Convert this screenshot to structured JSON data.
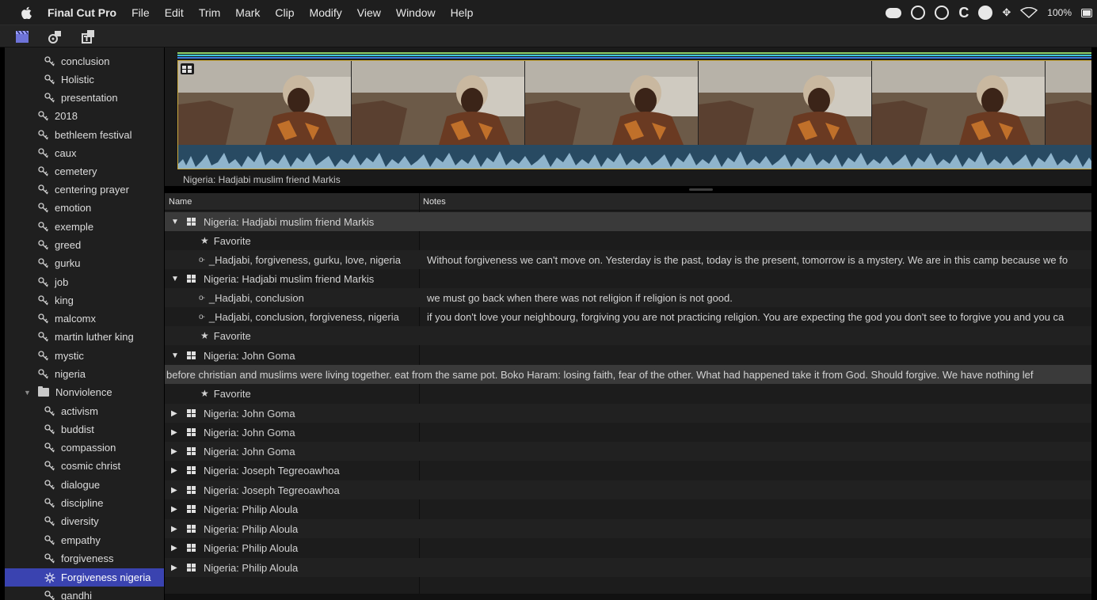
{
  "menubar": {
    "app_name": "Final Cut Pro",
    "items": [
      "File",
      "Edit",
      "Trim",
      "Mark",
      "Clip",
      "Modify",
      "View",
      "Window",
      "Help"
    ],
    "battery_label": "100%"
  },
  "filmstrip": {
    "clip_name": "Nigeria: Hadjabi muslim friend Markis"
  },
  "list": {
    "columns": {
      "name": "Name",
      "notes": "Notes"
    },
    "rows": [
      {
        "name": "Nigeria: Hadjabi muslim friend Markis",
        "notes": ""
      },
      {
        "name": "Favorite",
        "notes": ""
      },
      {
        "name": "_Hadjabi, forgiveness, gurku, love, nigeria",
        "notes": "Without forgiveness we can't move on. Yesterday is the past, today is the present, tomorrow is a mystery. We are in this camp because we fo"
      },
      {
        "name": "Nigeria: Hadjabi muslim friend Markis",
        "notes": ""
      },
      {
        "name": "_Hadjabi, conclusion",
        "notes": "we must go back when there was not religion if religion is not good."
      },
      {
        "name": "_Hadjabi, conclusion, forgiveness, nigeria",
        "notes": "if you don't love your neighbourg, forgiving you are not practicing religion. You are expecting the god you don't see to forgive you and you ca"
      },
      {
        "name": "Favorite",
        "notes": ""
      },
      {
        "name": "Nigeria: John Goma",
        "notes": ""
      },
      {
        "name": "before christian and muslims were living together. eat from the same pot. Boko Haram: losing faith, fear of the other. What had happened take it from God. Should forgive. We have nothing lef",
        "notes": ""
      },
      {
        "name": "Favorite",
        "notes": ""
      },
      {
        "name": "Nigeria: John Goma",
        "notes": ""
      },
      {
        "name": "Nigeria: John Goma",
        "notes": ""
      },
      {
        "name": "Nigeria: John Goma",
        "notes": ""
      },
      {
        "name": "Nigeria: Joseph Tegreoawhoa",
        "notes": ""
      },
      {
        "name": "Nigeria: Joseph Tegreoawhoa",
        "notes": ""
      },
      {
        "name": "Nigeria: Philip Aloula",
        "notes": ""
      },
      {
        "name": "Nigeria: Philip Aloula",
        "notes": ""
      },
      {
        "name": "Nigeria: Philip Aloula",
        "notes": ""
      },
      {
        "name": "Nigeria: Philip Aloula",
        "notes": ""
      }
    ]
  },
  "sidebar": {
    "items": [
      "conclusion",
      "Holistic",
      "presentation",
      "2018",
      "bethleem festival",
      "caux",
      "cemetery",
      "centering prayer",
      "emotion",
      "exemple",
      "greed",
      "gurku",
      "job",
      "king",
      "malcomx",
      "martin luther king",
      "mystic",
      "nigeria",
      "Nonviolence",
      "activism",
      "buddist",
      "compassion",
      "cosmic christ",
      "dialogue",
      "discipline",
      "diversity",
      "empathy",
      "forgiveness",
      "Forgiveness nigeria",
      "gandhi"
    ]
  },
  "colors": {
    "selection": "#3a43b0",
    "strip_border": "#caa93e",
    "waveform": "#284a62",
    "bar_green": "#8fd16b",
    "bar_cyan": "#3ec7d8",
    "bar_blue": "#3b7de0"
  }
}
